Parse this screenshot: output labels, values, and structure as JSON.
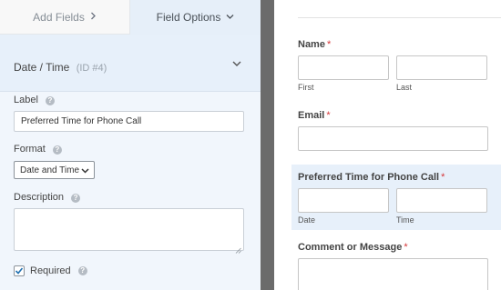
{
  "tabs": {
    "add_fields": "Add Fields",
    "field_options": "Field Options"
  },
  "field_settings": {
    "section_title": "Date / Time",
    "field_id": "(ID #4)",
    "label": {
      "caption": "Label",
      "value": "Preferred Time for Phone Call"
    },
    "format": {
      "caption": "Format",
      "selected": "Date and Time"
    },
    "description": {
      "caption": "Description",
      "value": ""
    },
    "required": {
      "caption": "Required",
      "checked": true
    },
    "help_glyph": "?"
  },
  "preview": {
    "required_marker": "*",
    "name": {
      "label": "Name",
      "first": "First",
      "last": "Last"
    },
    "email": {
      "label": "Email"
    },
    "preferred_time": {
      "label": "Preferred Time for Phone Call",
      "date": "Date",
      "time": "Time"
    },
    "comment": {
      "label": "Comment or Message"
    }
  },
  "colors": {
    "accent_check": "#2271b1",
    "required_star": "#d63638",
    "divider": "#6b6b6b"
  }
}
